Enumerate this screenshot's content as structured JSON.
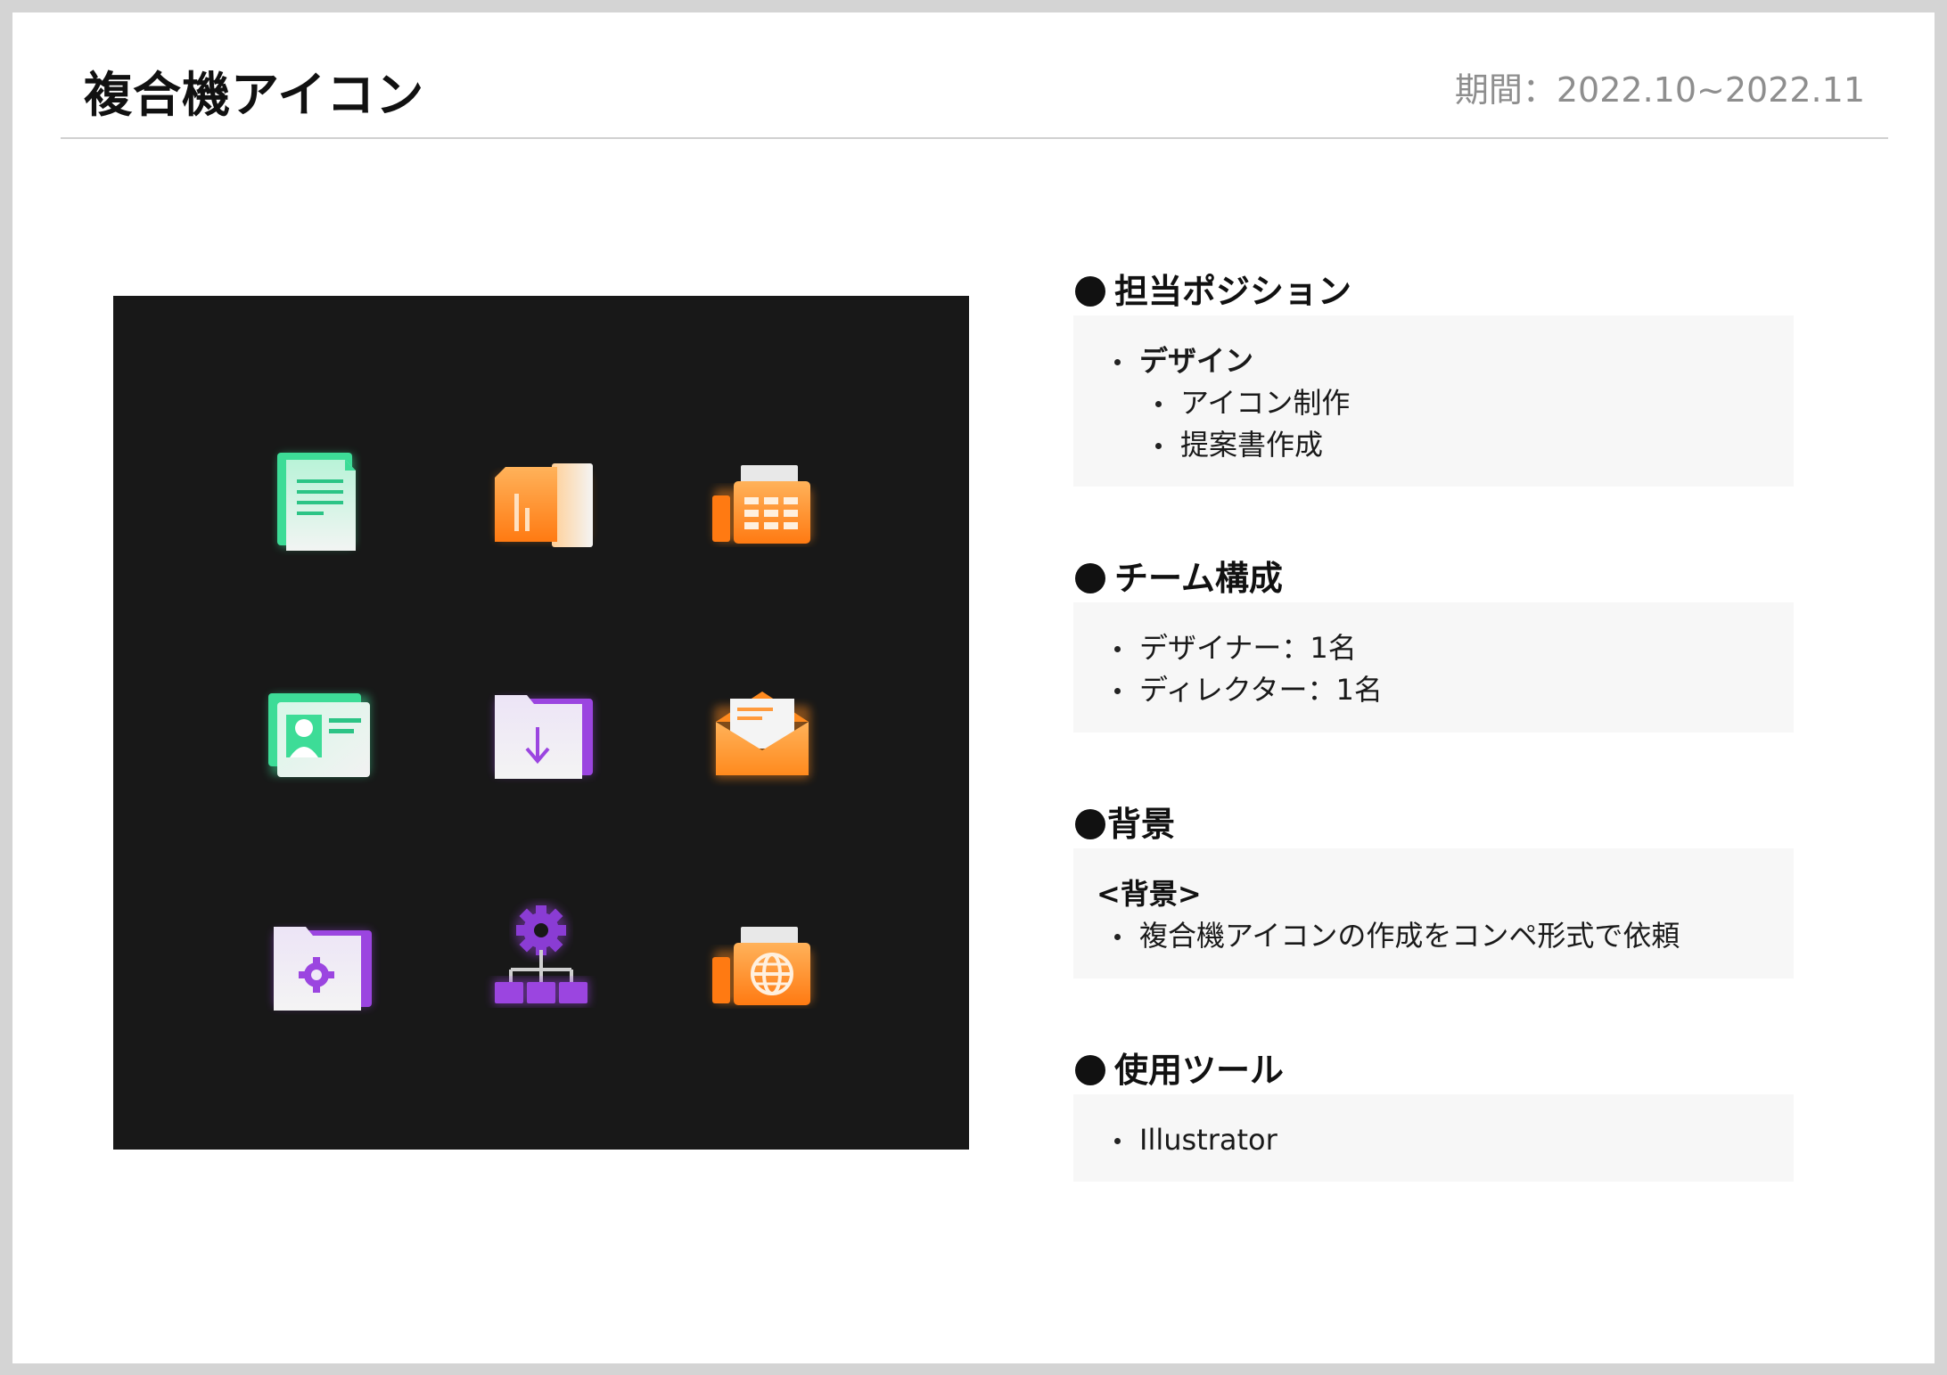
{
  "header": {
    "title": "複合機アイコン",
    "period": "期間：2022.10~2022.11"
  },
  "showcase": {
    "background": "#181818",
    "icons": [
      {
        "name": "document-icon",
        "color": "#3ddc97"
      },
      {
        "name": "binder-chart-icon",
        "color": "#ff8a1e"
      },
      {
        "name": "fax-machine-icon",
        "color": "#ff8a1e"
      },
      {
        "name": "id-card-icon",
        "color": "#3ddc97"
      },
      {
        "name": "download-folder-icon",
        "color": "#9b45e0"
      },
      {
        "name": "open-mail-icon",
        "color": "#ff8a1e"
      },
      {
        "name": "settings-folder-icon",
        "color": "#9b45e0"
      },
      {
        "name": "network-gear-icon",
        "color": "#9b45e0"
      },
      {
        "name": "fax-globe-icon",
        "color": "#ff8a1e"
      }
    ]
  },
  "sections": {
    "position": {
      "heading": "担当ポジション",
      "role": "デザイン",
      "tasks": [
        "アイコン制作",
        "提案書作成"
      ]
    },
    "team": {
      "heading": "チーム構成",
      "members": [
        "デザイナー：1名",
        "ディレクター：1名"
      ]
    },
    "background": {
      "heading": "背景",
      "subheading": "<背景>",
      "items": [
        "複合機アイコンの作成をコンペ形式で依頼"
      ]
    },
    "tools": {
      "heading": "使用ツール",
      "items": [
        "Illustrator"
      ]
    }
  }
}
